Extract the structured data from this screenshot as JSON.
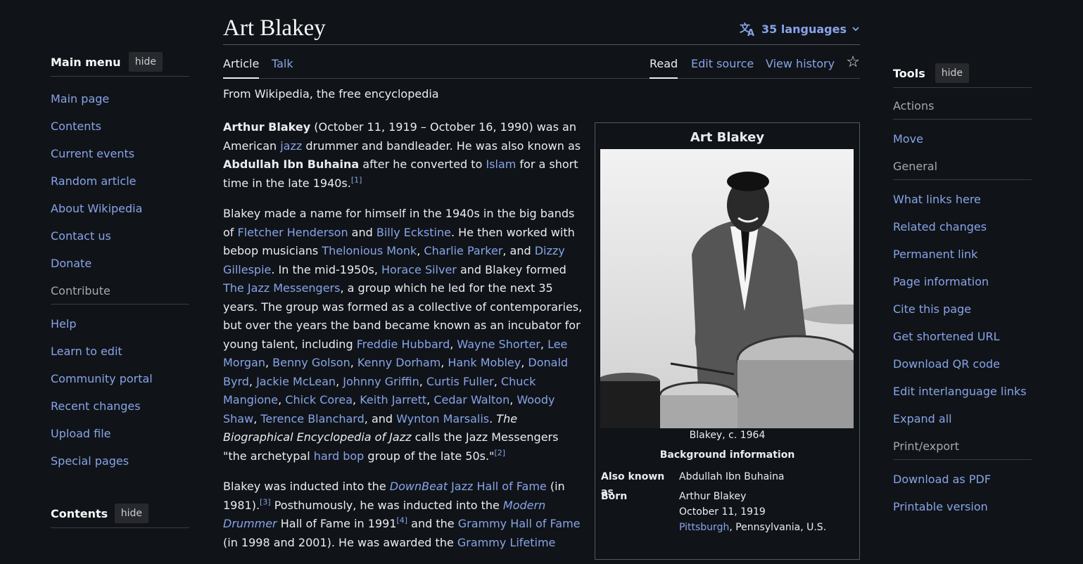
{
  "sidebar": {
    "title": "Main menu",
    "hide": "hide",
    "items": [
      "Main page",
      "Contents",
      "Current events",
      "Random article",
      "About Wikipedia",
      "Contact us",
      "Donate"
    ],
    "group2": "Contribute",
    "items2": [
      "Help",
      "Learn to edit",
      "Community portal",
      "Recent changes",
      "Upload file",
      "Special pages"
    ]
  },
  "contents": {
    "title": "Contents",
    "hide": "hide"
  },
  "page": {
    "title": "Art Blakey",
    "languages": "35 languages",
    "tabs": {
      "article": "Article",
      "talk": "Talk",
      "read": "Read",
      "edit": "Edit source",
      "history": "View history"
    },
    "tagline": "From Wikipedia, the free encyclopedia"
  },
  "body": {
    "p1": {
      "name": "Arthur Blakey",
      "t1": " (October 11, 1919 – October 16, 1990) was an American ",
      "l1": "jazz",
      "t2": " drummer and bandleader. He was also known as ",
      "alias": "Abdullah Ibn Buhaina",
      "t3": " after he converted to ",
      "l2": "Islam",
      "t4": " for a short time in the late 1940s.",
      "ref": "[1]"
    },
    "p2": {
      "t0": "Blakey made a name for himself in the 1940s in the big bands of ",
      "l1": "Fletcher Henderson",
      "t1": " and ",
      "l2": "Billy Eckstine",
      "t2": ". He then worked with bebop musicians ",
      "l3": "Thelonious Monk",
      "t3": ", ",
      "l4": "Charlie Parker",
      "t4": ", and ",
      "l5": "Dizzy Gillespie",
      "t5": ". In the mid-1950s, ",
      "l6": "Horace Silver",
      "t6": " and Blakey formed ",
      "l7": "The Jazz Messengers",
      "t7": ", a group which he led for the next 35 years. The group was formed as a collective of contemporaries, but over the years the band became known as an incubator for young talent, including ",
      "m1": "Freddie Hubbard",
      "m2": "Wayne Shorter",
      "m3": "Lee Morgan",
      "m4": "Benny Golson",
      "m5": "Kenny Dorham",
      "m6": "Hank Mobley",
      "m7": "Donald Byrd",
      "m8": "Jackie McLean",
      "m9": "Johnny Griffin",
      "m10": "Curtis Fuller",
      "m11": "Chuck Mangione",
      "m12": "Chick Corea",
      "m13": "Keith Jarrett",
      "m14": "Cedar Walton",
      "m15": "Woody Shaw",
      "m16": "Terence Blanchard",
      "and": ", and ",
      "m17": "Wynton Marsalis",
      "book": "The Biographical Encyclopedia of Jazz",
      "t8": " calls the Jazz Messengers \"the archetypal ",
      "l8": "hard bop",
      "t9": " group of the late 50s.\"",
      "ref": "[2]"
    },
    "p3": {
      "t0": "Blakey was inducted into the ",
      "l1i": "DownBeat",
      "l1": " Jazz Hall of Fame",
      "t1": " (in 1981).",
      "ref3": "[3]",
      "t2": " Posthumously, he was inducted into the ",
      "l2": "Modern Drummer",
      "t3": " Hall of Fame in 1991",
      "ref4": "[4]",
      "t4": " and the ",
      "l3": "Grammy Hall of Fame",
      "t5": " (in 1998 and 2001). He was awarded the ",
      "l4": "Grammy Lifetime"
    }
  },
  "infobox": {
    "title": "Art Blakey",
    "caption": "Blakey, c. 1964",
    "section": "Background information",
    "rows": {
      "aka_label": "Also known as",
      "aka": "Abdullah Ibn Buhaina",
      "born_label": "Born",
      "born1": "Arthur Blakey",
      "born2": "October 11, 1919",
      "born3_link": "Pittsburgh",
      "born3": ", Pennsylvania, U.S."
    }
  },
  "tools": {
    "title": "Tools",
    "hide": "hide",
    "g1": "Actions",
    "move": "Move",
    "g2": "General",
    "general": [
      "What links here",
      "Related changes",
      "Permanent link",
      "Page information",
      "Cite this page",
      "Get shortened URL",
      "Download QR code",
      "Edit interlanguage links",
      "Expand all"
    ],
    "g3": "Print/export",
    "print": [
      "Download as PDF",
      "Printable version"
    ]
  }
}
